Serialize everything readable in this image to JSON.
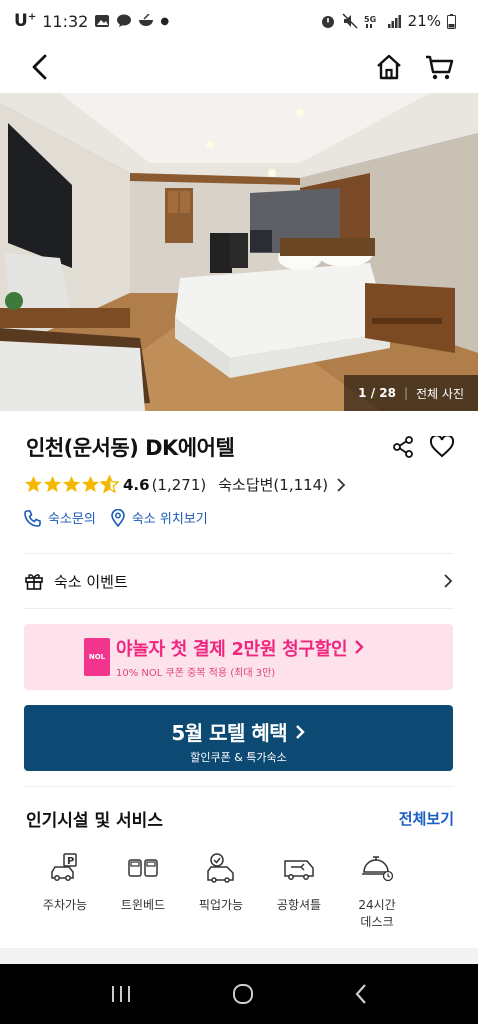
{
  "status_bar": {
    "carrier": "U",
    "carrier_sup": "+",
    "time": "11:32",
    "battery": "21%"
  },
  "hero": {
    "photo_index": "1 / 28",
    "all_photos_label": "전체 사진"
  },
  "hotel": {
    "title": "인천(운서동) DK에어텔",
    "rating": 4.6,
    "rating_text": "4.6",
    "rating_count": "(1,271)",
    "review_reply": "숙소답변(1,114)",
    "contact_label": "숙소문의",
    "location_label": "숙소 위치보기"
  },
  "event": {
    "label": "숙소 이벤트"
  },
  "promo_pink": {
    "logo": "NOL",
    "title": "야놀자 첫 결제 2만원 청구할인",
    "subtitle": "10% NOL 쿠폰 중복 적용 (최대 3만)"
  },
  "promo_blue": {
    "title": "5월 모텔 혜택",
    "subtitle": "할인쿠폰 & 특가숙소"
  },
  "amenities": {
    "title": "인기시설 및 서비스",
    "see_all": "전체보기",
    "items": [
      {
        "label": "주차가능",
        "icon": "parking-icon"
      },
      {
        "label": "트윈베드",
        "icon": "twin-bed-icon"
      },
      {
        "label": "픽업가능",
        "icon": "pickup-icon"
      },
      {
        "label": "공항셔틀",
        "icon": "shuttle-icon"
      },
      {
        "label": "24시간\n데스크",
        "icon": "front-desk-icon"
      }
    ]
  },
  "colors": {
    "link_blue": "#1c5ab8",
    "star_yellow": "#f5b800",
    "promo_pink_bg": "#fde2ec",
    "promo_pink_text": "#f0277e",
    "promo_blue_bg": "#0d4a73"
  }
}
